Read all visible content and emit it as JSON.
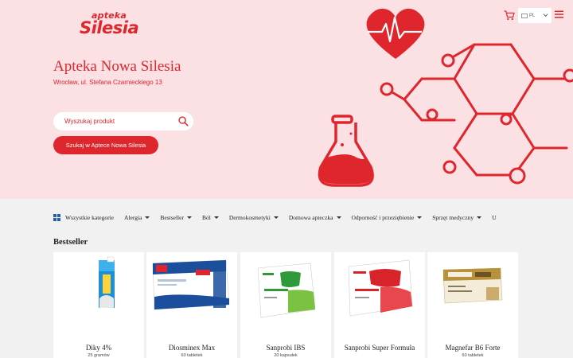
{
  "logo": {
    "line1": "apteka",
    "line2": "Silesia"
  },
  "pharmacy": {
    "name": "Apteka Nowa Silesia",
    "address": "Wrocław, ul. Stefana Czarnieckiego 13"
  },
  "search": {
    "placeholder": "Wyszukaj produkt",
    "button_label": "Szukaj w Aptece Nowa Silesia"
  },
  "header": {
    "language": "PL"
  },
  "nav": {
    "all_categories": "Wszystkie kategorie",
    "items": [
      {
        "label": "Alergia"
      },
      {
        "label": "Bestseller"
      },
      {
        "label": "Ból"
      },
      {
        "label": "Dermokosmetyki"
      },
      {
        "label": "Domowa apteczka"
      },
      {
        "label": "Odporność i przeziębienie"
      },
      {
        "label": "Sprzęt medyczny"
      },
      {
        "label": "U"
      }
    ]
  },
  "section": {
    "title": "Bestseller"
  },
  "products": [
    {
      "name": "Diky 4%",
      "qty": "25 gramów"
    },
    {
      "name": "Diosminex Max",
      "qty": "60 tabletek"
    },
    {
      "name": "Sanprobi IBS",
      "qty": "20 kapsułek"
    },
    {
      "name": "Sanprobi Super Formuła",
      "qty": ""
    },
    {
      "name": "Magnefar B6 Forte",
      "qty": "60 tabletek"
    }
  ],
  "colors": {
    "brand": "#e0262d",
    "hero_bg": "#fbe1e4",
    "page_bg": "#f1f1f2"
  },
  "icons": [
    "cart-icon",
    "menu-icon",
    "search-icon",
    "grid-icon",
    "heart-icon",
    "flask-icon"
  ]
}
